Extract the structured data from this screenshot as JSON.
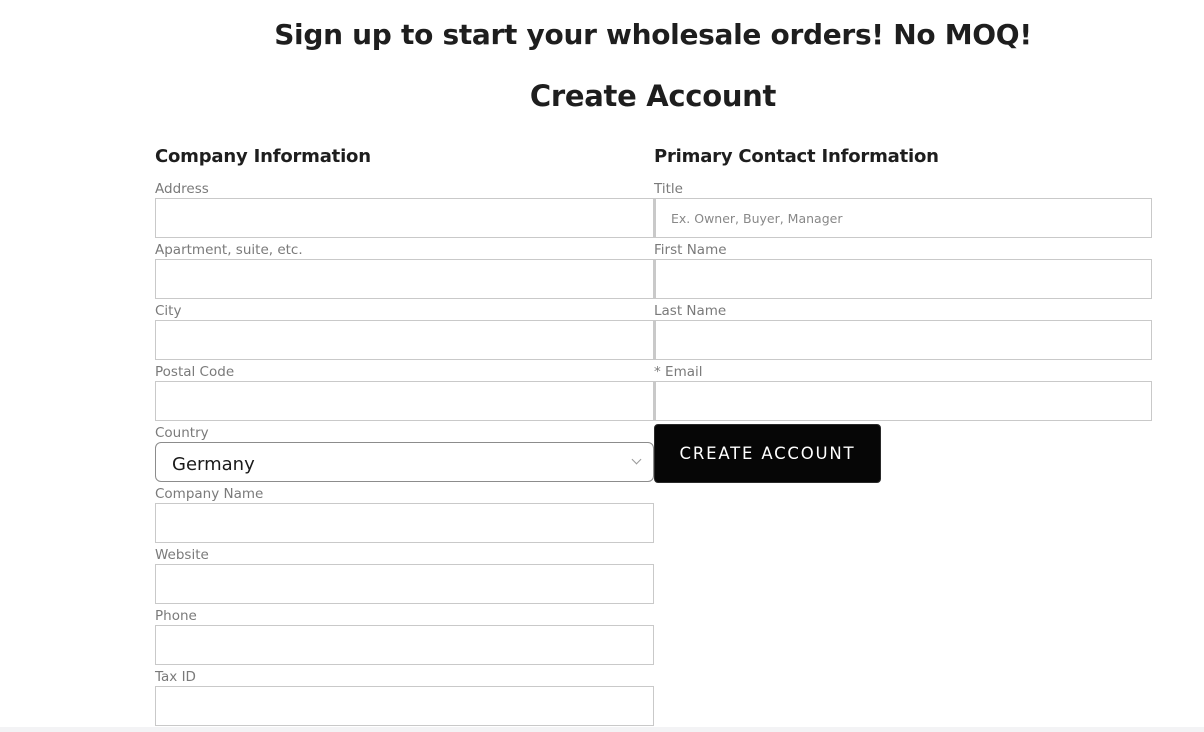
{
  "page": {
    "headline": "Sign up to start your wholesale orders! No MOQ!",
    "subheadline": "Create Account"
  },
  "company": {
    "title": "Company Information",
    "fields": {
      "address": {
        "label": "Address",
        "value": "",
        "placeholder": ""
      },
      "apartment": {
        "label": "Apartment, suite, etc.",
        "value": "",
        "placeholder": ""
      },
      "city": {
        "label": "City",
        "value": "",
        "placeholder": ""
      },
      "postal_code": {
        "label": "Postal Code",
        "value": "",
        "placeholder": ""
      },
      "country": {
        "label": "Country",
        "selected": "Germany"
      },
      "company_name": {
        "label": "Company Name",
        "value": "",
        "placeholder": ""
      },
      "website": {
        "label": "Website",
        "value": "",
        "placeholder": ""
      },
      "phone": {
        "label": "Phone",
        "value": "",
        "placeholder": ""
      },
      "tax_id": {
        "label": "Tax ID",
        "value": "",
        "placeholder": ""
      }
    }
  },
  "contact": {
    "title": "Primary Contact Information",
    "fields": {
      "title": {
        "label": "Title",
        "value": "",
        "placeholder": "Ex. Owner, Buyer, Manager"
      },
      "first_name": {
        "label": "First Name",
        "value": "",
        "placeholder": ""
      },
      "last_name": {
        "label": "Last Name",
        "value": "",
        "placeholder": ""
      },
      "email": {
        "label": "* Email",
        "value": "",
        "placeholder": ""
      }
    },
    "submit_label": "CREATE ACCOUNT"
  }
}
